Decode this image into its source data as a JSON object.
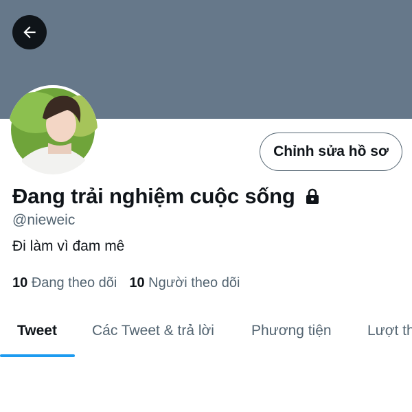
{
  "header": {
    "back_icon": "arrow-left-icon",
    "banner_color": "#66788a"
  },
  "profile": {
    "edit_button_label": "Chỉnh sửa hồ sơ",
    "display_name": "Đang trải nghiệm cuộc sống",
    "protected_icon": "lock-icon",
    "handle": "@nieweic",
    "bio": "Đi làm vì đam mê",
    "following_count": "10",
    "following_label": "Đang theo dõi",
    "followers_count": "10",
    "followers_label": "Người theo dõi"
  },
  "tabs": [
    {
      "label": "Tweet",
      "active": true
    },
    {
      "label": "Các Tweet & trả lời",
      "active": false
    },
    {
      "label": "Phương tiện",
      "active": false
    },
    {
      "label": "Lượt th",
      "active": false
    }
  ],
  "colors": {
    "accent": "#1d9bf0",
    "text_primary": "#0f1419",
    "text_secondary": "#536471"
  }
}
